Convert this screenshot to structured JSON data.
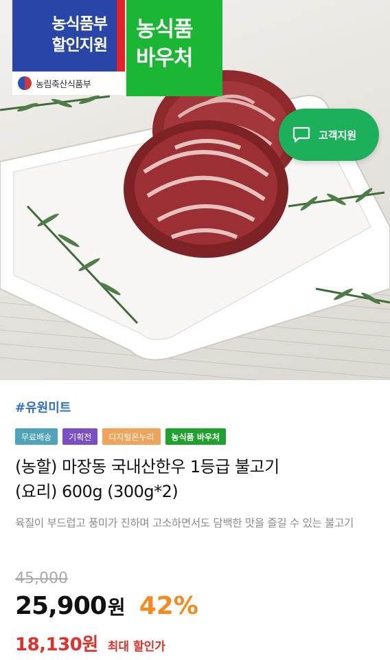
{
  "hero": {
    "badge_blue_line1": "농식품부",
    "badge_blue_line2": "할인지원",
    "ministry_label": "농림축산식품부",
    "badge_green_line1": "농식품",
    "badge_green_line2": "바우처",
    "customer_support_label": "고객지원"
  },
  "product": {
    "seller": "#유원미트",
    "tags": [
      "무료배송",
      "기획전",
      "디지털온누리",
      "농식품 바우처"
    ],
    "title_line1": "(농할) 마장동 국내산한우 1등급 불고기",
    "title_line2": "(요리) 600g (300g*2)",
    "description": "육질이 부드럽고 풍미가 진하며 고소하면서도 담백한 맛을 즐길 수 있는 불고기",
    "original_price": "45,000",
    "price": "25,900",
    "price_unit": "원",
    "discount": "42%",
    "max_discount_price": "18,130원",
    "max_discount_label": "최대 할인가"
  },
  "colors": {
    "seller": "#2f6fc7",
    "discount": "#f58a1f",
    "max_price": "#e0302a",
    "voucher_green": "#19b734",
    "support_green": "#1cb05a"
  }
}
